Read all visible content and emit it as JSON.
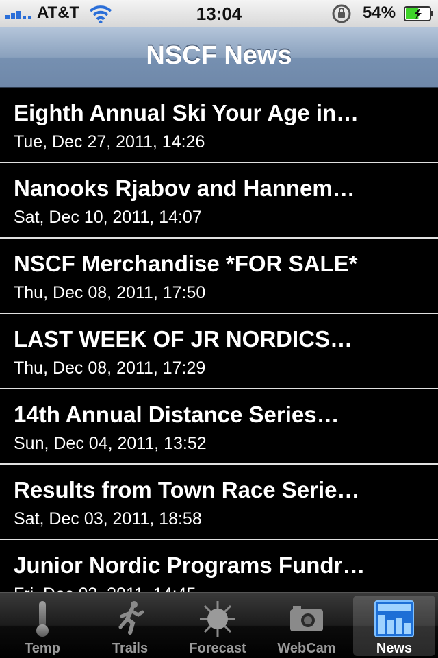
{
  "status_bar": {
    "carrier": "AT&T",
    "time": "13:04",
    "battery_percent": "54%",
    "signal_icon": "signal-bars-icon",
    "wifi_icon": "wifi-icon",
    "lock_icon": "rotation-lock-icon",
    "battery_icon": "battery-charging-icon",
    "battery_level": 0.54
  },
  "nav_bar": {
    "title": "NSCF News"
  },
  "news": [
    {
      "title": "Eighth Annual Ski Your Age in…",
      "date": "Tue, Dec 27, 2011, 14:26"
    },
    {
      "title": "Nanooks Rjabov and Hannem…",
      "date": "Sat, Dec 10, 2011, 14:07"
    },
    {
      "title": "NSCF Merchandise *FOR SALE*",
      "date": "Thu, Dec 08, 2011, 17:50"
    },
    {
      "title": "LAST WEEK OF JR NORDICS…",
      "date": "Thu, Dec 08, 2011, 17:29"
    },
    {
      "title": "14th Annual Distance Series…",
      "date": "Sun, Dec 04, 2011, 13:52"
    },
    {
      "title": "Results from Town Race Serie…",
      "date": "Sat, Dec 03, 2011, 18:58"
    },
    {
      "title": "Junior Nordic Programs Fundr…",
      "date": "Fri, Dec 02, 2011, 14:45"
    }
  ],
  "tab_bar": {
    "tabs": [
      {
        "label": "Temp",
        "icon": "thermometer-icon"
      },
      {
        "label": "Trails",
        "icon": "runner-icon"
      },
      {
        "label": "Forecast",
        "icon": "sun-icon"
      },
      {
        "label": "WebCam",
        "icon": "camera-icon"
      },
      {
        "label": "News",
        "icon": "newspaper-icon"
      }
    ],
    "selected": "News"
  },
  "colors": {
    "accent": "#2a6ed8",
    "nav_bar": "#7690b1",
    "background": "#000000",
    "battery_green": "#3fd42a"
  }
}
